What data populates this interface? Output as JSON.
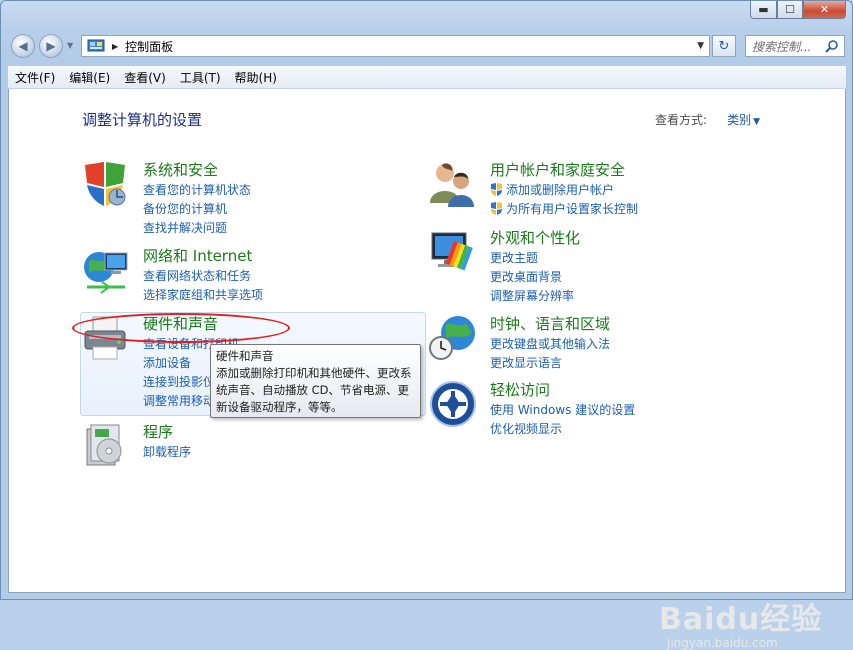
{
  "window": {
    "caption_buttons": {
      "minimize": "▬",
      "maximize": "☐",
      "close": "✕"
    }
  },
  "address_bar": {
    "breadcrumb_separator": "▶",
    "path": "控制面板",
    "dropdown": "▼",
    "refresh": "↻",
    "search_placeholder": "搜索控制..."
  },
  "menubar": {
    "items": [
      "文件(F)",
      "编辑(E)",
      "查看(V)",
      "工具(T)",
      "帮助(H)"
    ]
  },
  "content": {
    "title": "调整计算机的设置",
    "view_by_label": "查看方式:",
    "view_by_value": "类别",
    "view_by_arrow": "▼"
  },
  "categories": [
    {
      "title": "系统和安全",
      "links": [
        "查看您的计算机状态",
        "备份您的计算机",
        "查找并解决问题"
      ]
    },
    {
      "title": "网络和 Internet",
      "links": [
        "查看网络状态和任务",
        "选择家庭组和共享选项"
      ]
    },
    {
      "title": "硬件和声音",
      "links": [
        "查看设备和打印机",
        "添加设备",
        "连接到投影仪",
        "调整常用移动"
      ]
    },
    {
      "title": "程序",
      "links": [
        "卸载程序"
      ]
    },
    {
      "title": "用户帐户和家庭安全",
      "links": [
        "添加或删除用户帐户",
        "为所有用户设置家长控制"
      ]
    },
    {
      "title": "外观和个性化",
      "links": [
        "更改主题",
        "更改桌面背景",
        "调整屏幕分辨率"
      ]
    },
    {
      "title": "时钟、语言和区域",
      "links": [
        "更改键盘或其他输入法",
        "更改显示语言"
      ]
    },
    {
      "title": "轻松访问",
      "links": [
        "使用 Windows 建议的设置",
        "优化视频显示"
      ]
    }
  ],
  "tooltip": {
    "title": "硬件和声音",
    "body": "添加或删除打印机和其他硬件、更改系统声音、自动播放 CD、节省电源、更新设备驱动程序，等等。"
  },
  "watermark": {
    "logo": "Baidu经验",
    "url": "jingyan.baidu.com"
  },
  "colors": {
    "category_title": "#1b7b1b",
    "link": "#1d5fb0",
    "page_title": "#1e3287",
    "highlight_ellipse": "#e02020"
  }
}
